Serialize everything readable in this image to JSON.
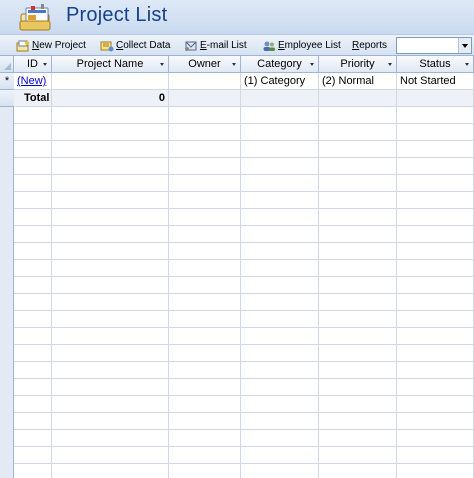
{
  "header": {
    "title": "Project List"
  },
  "toolbar": {
    "new_project": {
      "accel": "N",
      "rest": "ew Project"
    },
    "collect_data": {
      "accel": "C",
      "rest": "ollect Data"
    },
    "email_list": {
      "accel": "E",
      "rest": "-mail List"
    },
    "employee_list": {
      "accel": "E",
      "rest": "mployee List"
    },
    "reports": {
      "accel": "R",
      "rest": "eports"
    },
    "report_select_value": ""
  },
  "table": {
    "columns": [
      "ID",
      "Project Name",
      "Owner",
      "Category",
      "Priority",
      "Status"
    ],
    "new_row": {
      "marker": "*",
      "id": "(New)",
      "project_name": "",
      "owner": "",
      "category": "(1) Category",
      "priority": "(2) Normal",
      "status": "Not Started"
    },
    "total_row": {
      "label": "Total",
      "project_count": "0"
    }
  },
  "colors": {
    "title": "#15428b",
    "header_bg": "#dfe9f6",
    "gridline": "#d0d7e5",
    "link": "#0000cc"
  }
}
